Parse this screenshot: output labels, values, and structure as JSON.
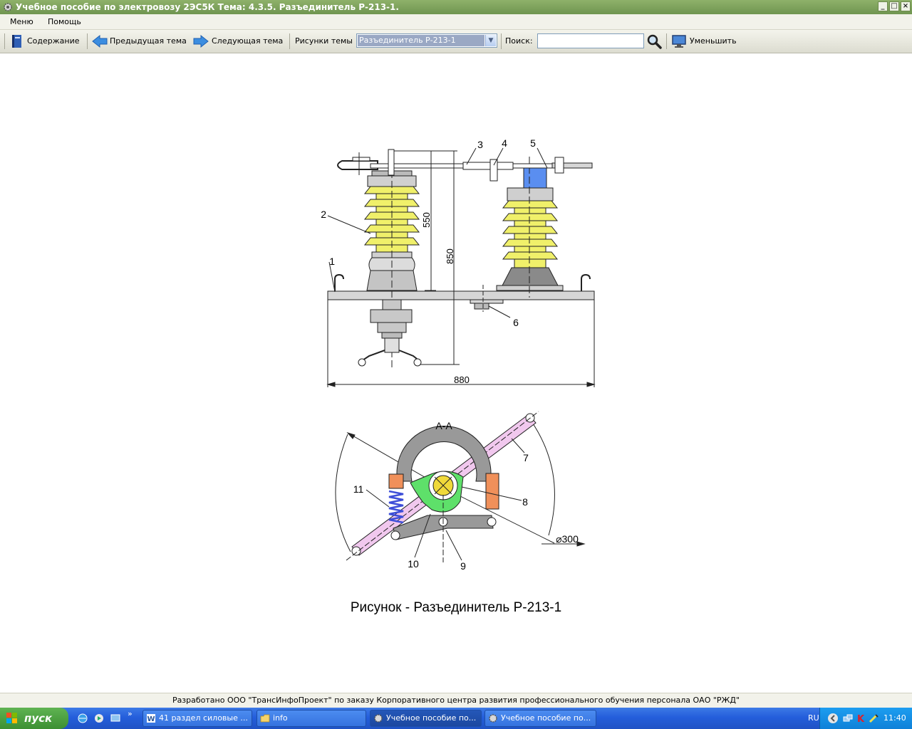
{
  "window": {
    "title": "Учебное пособие по электровозу 2ЭС5К Тема: 4.3.5. Разъединитель Р-213-1."
  },
  "menu": {
    "items": [
      "Меню",
      "Помощь"
    ]
  },
  "toolbar": {
    "contents_label": "Содержание",
    "prev_label": "Предыдущая тема",
    "next_label": "Следующая тема",
    "figures_label": "Рисунки темы",
    "figures_selected": "Разъединитель Р-213-1",
    "search_label": "Поиск:",
    "search_value": "",
    "reduce_label": "Уменьшить"
  },
  "figure": {
    "caption": "Рисунок - Разъединитель Р-213-1",
    "labels": {
      "n1": "1",
      "n2": "2",
      "n3": "3",
      "n4": "4",
      "n5": "5",
      "n6": "6",
      "n7": "7",
      "n8": "8",
      "n9": "9",
      "n10": "10",
      "n11": "11",
      "section": "А-А",
      "dim_550": "550",
      "dim_850": "850",
      "dim_880": "880",
      "dim_300": "⌀300"
    },
    "colors": {
      "insulator": "#f0f06a",
      "contact_block": "#5a8ef0",
      "rod": "#f1c8ee",
      "cam": "#5ee06a",
      "spring": "#3d4ed8",
      "bushing": "#f0905a",
      "shaft": "#f0d93a"
    }
  },
  "footer": {
    "text": "Разработано ООО \"ТрансИнфоПроект\" по заказу Корпоративного центра развития профессионального обучения персонала ОАО \"РЖД\""
  },
  "taskbar": {
    "start_label": "пуск",
    "tasks": [
      "41 раздел силовые ...",
      "info",
      "Учебное пособие по...",
      "Учебное пособие по..."
    ],
    "language": "RU",
    "clock": "11:40"
  }
}
